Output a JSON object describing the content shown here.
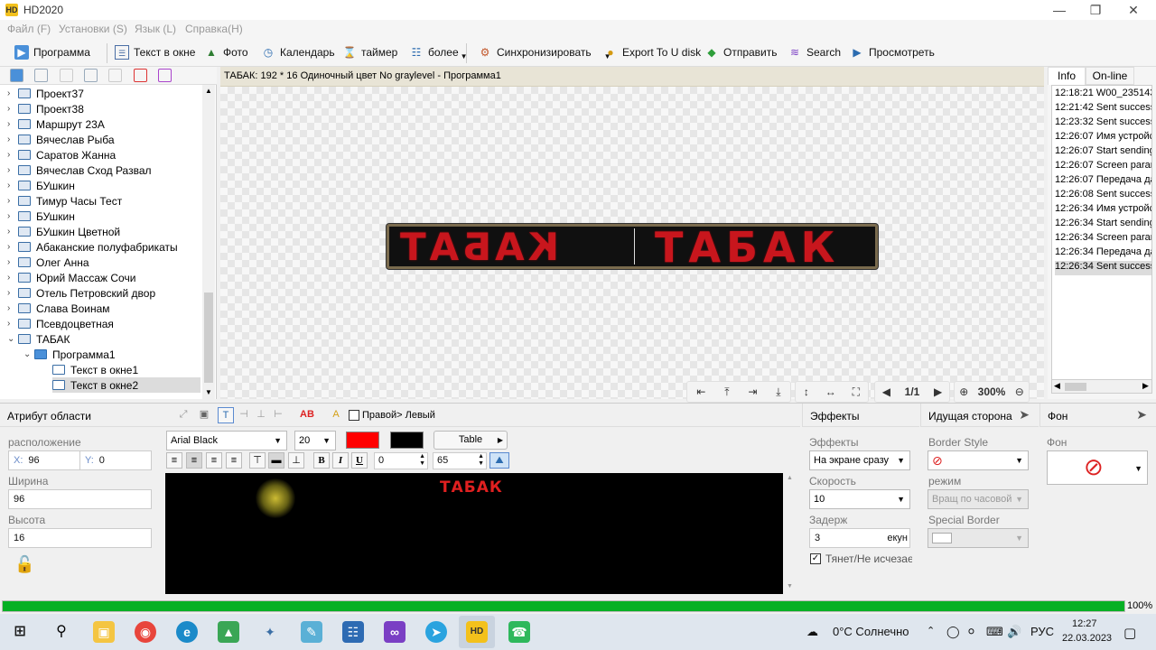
{
  "window": {
    "title": "HD2020"
  },
  "menu": [
    "Файл (F)",
    "Установки (S)",
    "Язык (L)",
    "Справка(H)"
  ],
  "toolbar": {
    "program": "Программа",
    "text_window": "Текст в окне",
    "photo": "Фото",
    "calendar": "Календарь",
    "timer": "таймер",
    "more": "более",
    "sync": "Синхронизировать",
    "export": "Export To U disk",
    "send": "Отправить",
    "search": "Search",
    "view": "Просмотреть"
  },
  "tree": {
    "items": [
      {
        "label": "Проект37"
      },
      {
        "label": "Проект38"
      },
      {
        "label": "Маршрут 23А"
      },
      {
        "label": "Вячеслав Рыба"
      },
      {
        "label": "Саратов Жанна"
      },
      {
        "label": "Вячеслав Сход Развал"
      },
      {
        "label": "БУшкин"
      },
      {
        "label": "Тимур Часы Тест"
      },
      {
        "label": "БУшкин"
      },
      {
        "label": "БУшкин Цветной"
      },
      {
        "label": "Абаканские полуфабрикаты"
      },
      {
        "label": "Олег Анна"
      },
      {
        "label": "Юрий Массаж Сочи"
      },
      {
        "label": "Отель Петровский двор"
      },
      {
        "label": "Слава Воинам"
      },
      {
        "label": "Псевдоцветная"
      },
      {
        "label": "ТАБАК"
      }
    ],
    "program": "Программа1",
    "windows": [
      "Текст в окне1",
      "Текст в окне2"
    ]
  },
  "preview": {
    "header": "ТАБАК: 192 * 16 Одиночный цвет No graylevel - Программа1",
    "led_text_main": "ТАБАК",
    "led_text_scroll": "КАБАТ",
    "page": "1/1",
    "zoom": "300%",
    "led_color": "#c8161d"
  },
  "info": {
    "tabs": [
      "Info",
      "On-line"
    ],
    "log": [
      "12:18:21 W00_2351438",
      "12:21:42 Sent successf",
      "12:23:32 Sent successf",
      "12:26:07 Имя устройс",
      "12:26:07 Start sending",
      "12:26:07 Screen param",
      "12:26:07 Передача да",
      "12:26:08 Sent successf",
      "12:26:34 Имя устройс",
      "12:26:34 Start sending",
      "12:26:34 Screen param",
      "12:26:34 Передача да",
      "12:26:34 Sent successf"
    ]
  },
  "area_attr": {
    "title": "Атрибут области",
    "location_label": "расположение",
    "x_prefix": "X:",
    "x": "96",
    "y_prefix": "Y:",
    "y": "0",
    "width_label": "Ширина",
    "width": "96",
    "height_label": "Высота",
    "height": "16"
  },
  "text_editor": {
    "direction_label": "Правой> Левый",
    "font": "Arial Black",
    "size": "20",
    "table_label": "Table",
    "spin1": "0",
    "spin2": "65",
    "text": "ТАБАК",
    "text_color": "#ff0000",
    "bg_color": "#000000",
    "bold": "B",
    "italic": "I",
    "underline": "U",
    "ab_label": "AB"
  },
  "effects": {
    "title": "Эффекты",
    "effects_label": "Эффекты",
    "effect_value": "На экране сразу",
    "speed_label": "Скорость",
    "speed_value": "10",
    "delay_label": "Задерж",
    "delay_value": "3",
    "delay_unit": "екун",
    "checkbox_label": "Тянет/Не исчезае"
  },
  "side": {
    "title": "Идущая сторона",
    "border_style_label": "Border Style",
    "mode_label": "режим",
    "mode_value": "Вращ по часовой",
    "special_border_label": "Special Border"
  },
  "bg": {
    "title": "Фон",
    "label": "Фон"
  },
  "progress": {
    "value": 100,
    "label": "100%"
  },
  "taskbar": {
    "weather": "0°C  Солнечно",
    "lang": "РУС",
    "time": "12:27",
    "date": "22.03.2023"
  }
}
